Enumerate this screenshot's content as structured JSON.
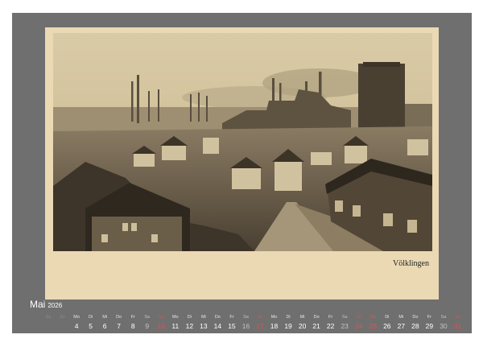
{
  "photo": {
    "caption": "Völklingen",
    "colors": {
      "sky": "#d7c8a2",
      "smoke": "#8e826c",
      "dark": "#3f372b",
      "mid": "#7a6c56",
      "light": "#c9b994"
    }
  },
  "month": {
    "name": "Mai",
    "year": "2026"
  },
  "days": [
    {
      "wd": "Sa",
      "d": "",
      "kind": "empty"
    },
    {
      "wd": "So",
      "d": "",
      "kind": "empty"
    },
    {
      "wd": "Mo",
      "d": "4",
      "kind": "weekday"
    },
    {
      "wd": "Di",
      "d": "5",
      "kind": "weekday"
    },
    {
      "wd": "Mi",
      "d": "6",
      "kind": "weekday"
    },
    {
      "wd": "Do",
      "d": "7",
      "kind": "weekday"
    },
    {
      "wd": "Fr",
      "d": "8",
      "kind": "weekday"
    },
    {
      "wd": "Sa",
      "d": "9",
      "kind": "sat"
    },
    {
      "wd": "So",
      "d": "10",
      "kind": "sun"
    },
    {
      "wd": "Mo",
      "d": "11",
      "kind": "weekday"
    },
    {
      "wd": "Di",
      "d": "12",
      "kind": "weekday"
    },
    {
      "wd": "Mi",
      "d": "13",
      "kind": "weekday"
    },
    {
      "wd": "Do",
      "d": "14",
      "kind": "weekday"
    },
    {
      "wd": "Fr",
      "d": "15",
      "kind": "weekday"
    },
    {
      "wd": "Sa",
      "d": "16",
      "kind": "sat"
    },
    {
      "wd": "So",
      "d": "17",
      "kind": "sun"
    },
    {
      "wd": "Mo",
      "d": "18",
      "kind": "weekday"
    },
    {
      "wd": "Di",
      "d": "19",
      "kind": "weekday"
    },
    {
      "wd": "Mi",
      "d": "20",
      "kind": "weekday"
    },
    {
      "wd": "Do",
      "d": "21",
      "kind": "weekday"
    },
    {
      "wd": "Fr",
      "d": "22",
      "kind": "weekday"
    },
    {
      "wd": "Sa",
      "d": "23",
      "kind": "sat"
    },
    {
      "wd": "So",
      "d": "24",
      "kind": "sun"
    },
    {
      "wd": "Mo",
      "d": "25",
      "kind": "sun"
    },
    {
      "wd": "Di",
      "d": "26",
      "kind": "weekday"
    },
    {
      "wd": "Mi",
      "d": "27",
      "kind": "weekday"
    },
    {
      "wd": "Do",
      "d": "28",
      "kind": "weekday"
    },
    {
      "wd": "Fr",
      "d": "29",
      "kind": "weekday"
    },
    {
      "wd": "Sa",
      "d": "30",
      "kind": "sat"
    },
    {
      "wd": "So",
      "d": "31",
      "kind": "sun"
    }
  ]
}
